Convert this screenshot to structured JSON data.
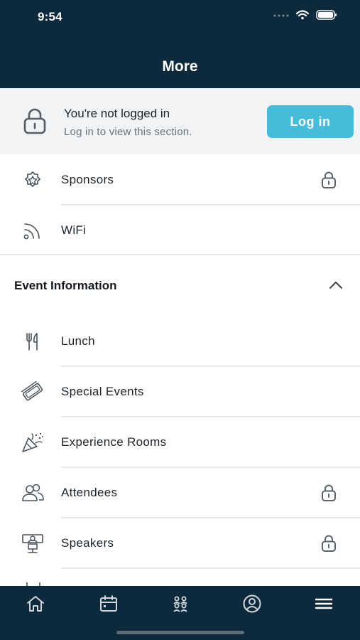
{
  "status": {
    "time": "9:54"
  },
  "header": {
    "title": "More"
  },
  "login": {
    "title": "You're not logged in",
    "subtitle": "Log in to view this section.",
    "button": "Log in"
  },
  "items_top": [
    {
      "label": "Sponsors",
      "icon": "star-badge-icon",
      "locked": true
    },
    {
      "label": "WiFi",
      "icon": "wifi-signal-icon",
      "locked": false
    }
  ],
  "section": {
    "title": "Event Information",
    "expanded": true
  },
  "items_event": [
    {
      "label": "Lunch",
      "icon": "fork-knife-icon",
      "locked": false
    },
    {
      "label": "Special Events",
      "icon": "tickets-icon",
      "locked": false
    },
    {
      "label": "Experience Rooms",
      "icon": "party-popper-icon",
      "locked": false
    },
    {
      "label": "Attendees",
      "icon": "people-icon",
      "locked": true
    },
    {
      "label": "Speakers",
      "icon": "podium-speaker-icon",
      "locked": true
    }
  ],
  "tabs": [
    {
      "name": "home-icon"
    },
    {
      "name": "calendar-icon"
    },
    {
      "name": "group-icon"
    },
    {
      "name": "profile-icon"
    },
    {
      "name": "menu-icon"
    }
  ],
  "colors": {
    "header_bg": "#0d2a3d",
    "accent": "#45bcd9",
    "banner_bg": "#f1f3f4"
  }
}
